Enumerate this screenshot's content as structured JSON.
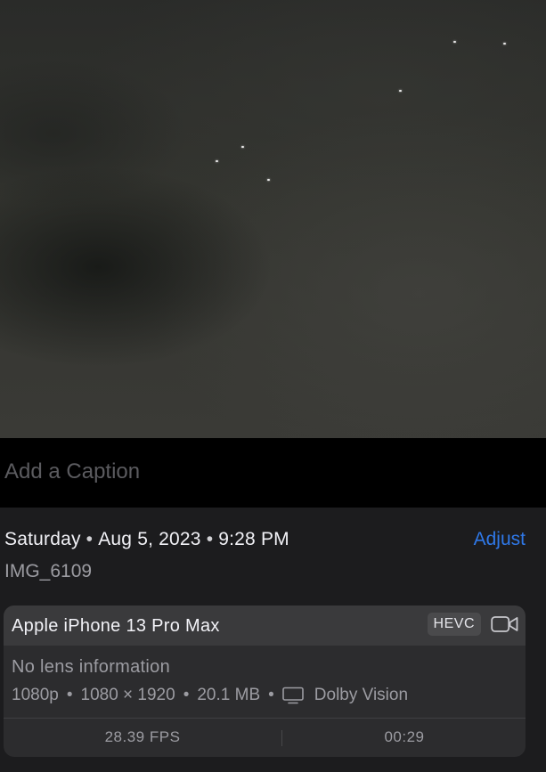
{
  "caption": {
    "placeholder": "Add a Caption",
    "value": ""
  },
  "metadata": {
    "day": "Saturday",
    "date": "Aug 5, 2023",
    "time": "9:28 PM",
    "separator": "•",
    "adjust_label": "Adjust",
    "filename": "IMG_6109"
  },
  "card": {
    "device": "Apple iPhone 13 Pro Max",
    "codec_badge": "HEVC",
    "lens": "No lens information",
    "resolution": "1080p",
    "dimensions": "1080 × 1920",
    "file_size": "20.1 MB",
    "spec_separator": "•",
    "hdr": "Dolby Vision",
    "fps": "28.39 FPS",
    "duration": "00:29"
  },
  "icons": {
    "video": "video-camera-icon",
    "display": "display-icon"
  },
  "colors": {
    "accent": "#2f78e8",
    "background": "#1c1c1e",
    "card": "#2c2c2e",
    "card_header": "#3a3a3c",
    "secondary_text": "#9c9ca2"
  }
}
